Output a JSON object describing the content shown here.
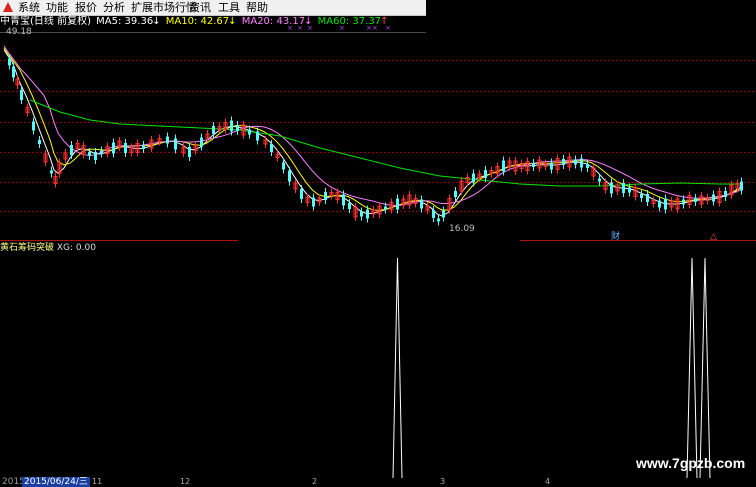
{
  "menu": {
    "items": [
      "系统",
      "功能",
      "报价",
      "分析",
      "扩展市场行情",
      "资讯",
      "工具",
      "帮助"
    ]
  },
  "info": {
    "stock_label": "中青宝(日线 前复权)",
    "ma5": "MA5: 39.36",
    "ma5_arrow": "↓",
    "ma10": "MA10: 42.67",
    "ma10_arrow": "↓",
    "ma20": "MA20: 43.17",
    "ma20_arrow": "↓",
    "ma60": "MA60: 37.37",
    "ma60_arrow": "↑"
  },
  "price_labels": {
    "top": "49.18",
    "bottom": "16.09"
  },
  "markers": {
    "cai": "财",
    "jiao": "△"
  },
  "indicator": {
    "name": "黄石筹码突破",
    "value_label": "XG: 0.00"
  },
  "dates": {
    "prefix": "2015",
    "selected": "2015/06/24/三",
    "ticks": [
      "11",
      "12",
      "2",
      "3",
      "4"
    ]
  },
  "watermark": "www.7gpzb.com",
  "colors": {
    "up": "#ff3232",
    "down": "#54fcfc",
    "ma5": "#ffffff",
    "ma10": "#ffff00",
    "ma20": "#ff80ff",
    "ma60": "#00e600",
    "grid": "#8b0000"
  },
  "chart_data": {
    "type": "candlestick",
    "y_range": [
      16.09,
      49.18
    ],
    "signal_spikes": 3,
    "indicator_value": 0.0
  }
}
